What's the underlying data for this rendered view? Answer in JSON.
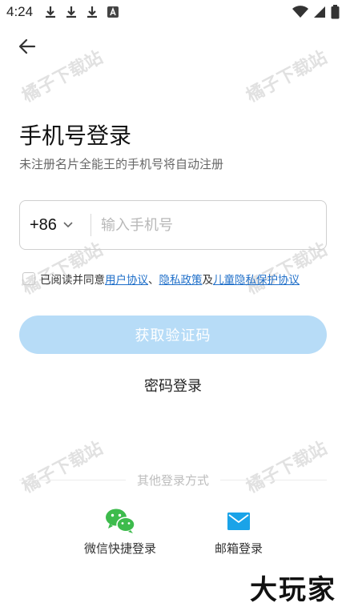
{
  "status_bar": {
    "time": "4:24",
    "left_icons": [
      "download-icon",
      "download-icon",
      "download-icon",
      "a-box-icon"
    ],
    "right_icons": [
      "wifi-icon",
      "signal-icon",
      "battery-icon"
    ]
  },
  "header": {
    "back_icon": "arrow-left-icon"
  },
  "login": {
    "title": "手机号登录",
    "subtitle": "未注册名片全能王的手机号将自动注册",
    "country_code": "+86",
    "phone_placeholder": "输入手机号",
    "phone_value": ""
  },
  "agreement": {
    "prefix": "已阅读并同意",
    "link_user": "用户协议",
    "sep1": "、",
    "link_privacy": "隐私政策",
    "sep2": "及",
    "link_child": "儿童隐私保护协议"
  },
  "actions": {
    "get_code": "获取验证码",
    "password_login": "密码登录"
  },
  "other_login": {
    "label": "其他登录方式",
    "wechat": "微信快捷登录",
    "email": "邮箱登录"
  },
  "watermark": {
    "text": "橘子下载站",
    "brand": "大玩家"
  },
  "colors": {
    "accent": "#1f6fc9",
    "button_disabled": "#b7dcf7",
    "wechat_green": "#3dbb4c",
    "email_blue": "#1aa3e8"
  }
}
